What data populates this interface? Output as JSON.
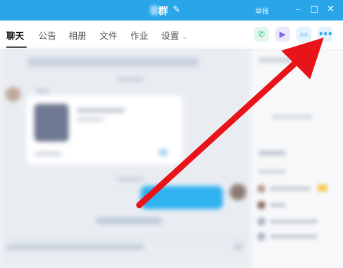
{
  "titlebar": {
    "title": "群",
    "report_label": "举报",
    "edit_icon": "pencil-icon",
    "buttons": [
      "minimize-icon",
      "maximize-icon",
      "close-icon"
    ]
  },
  "tabs": [
    {
      "label": "聊天",
      "active": true
    },
    {
      "label": "公告"
    },
    {
      "label": "相册"
    },
    {
      "label": "文件"
    },
    {
      "label": "作业"
    },
    {
      "label": "设置"
    }
  ],
  "actions": [
    {
      "name": "voice-call-icon",
      "glyph": "✆",
      "color": "#2ec27e"
    },
    {
      "name": "video-call-icon",
      "glyph": "▶",
      "color": "#7b6cf0"
    },
    {
      "name": "screen-share-icon",
      "glyph": "▭",
      "color": "#22a7f0"
    },
    {
      "name": "more-icon",
      "glyph": "•••",
      "color": "#22a7f0"
    }
  ],
  "colors": {
    "titlebar": "#29a6ea",
    "accent": "#22a7f0",
    "arrow": "#e8141a"
  }
}
